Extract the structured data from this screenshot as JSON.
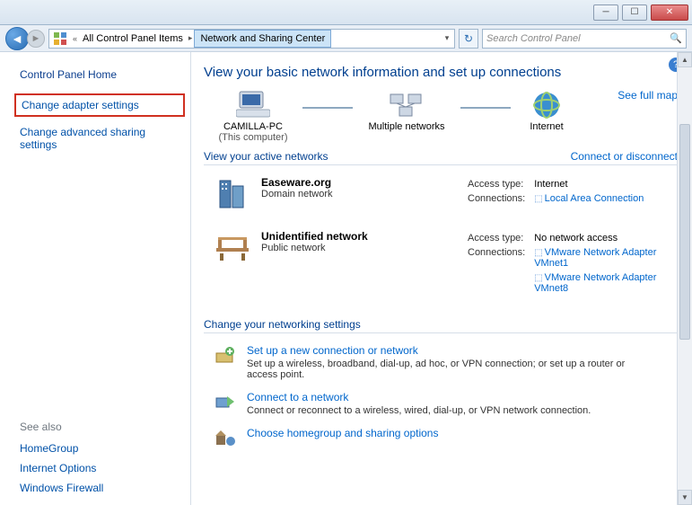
{
  "titlebar": {
    "min": "─",
    "max": "☐",
    "close": "✕"
  },
  "address": {
    "back_glyph": "◄",
    "fwd_glyph": "►",
    "chevrons": "«",
    "crumb1": "All Control Panel Items",
    "crumb2": "Network and Sharing Center",
    "dropdown_glyph": "▾",
    "refresh_glyph": "↻",
    "search_placeholder": "Search Control Panel",
    "search_glyph": "🔍"
  },
  "sidebar": {
    "home": "Control Panel Home",
    "adapter": "Change adapter settings",
    "advanced": "Change advanced sharing settings",
    "seealso": "See also",
    "links": [
      "HomeGroup",
      "Internet Options",
      "Windows Firewall"
    ]
  },
  "main": {
    "help_glyph": "?",
    "title": "View your basic network information and set up connections",
    "map": {
      "pc_name": "CAMILLA-PC",
      "pc_sub": "(This computer)",
      "mid": "Multiple networks",
      "internet": "Internet",
      "full_map": "See full map"
    },
    "active": {
      "heading": "View your active networks",
      "rightlink": "Connect or disconnect",
      "net1": {
        "name": "Easeware.org",
        "type": "Domain network",
        "access_lbl": "Access type:",
        "access_val": "Internet",
        "conn_lbl": "Connections:",
        "conn_val": "Local Area Connection"
      },
      "net2": {
        "name": "Unidentified network",
        "type": "Public network",
        "access_lbl": "Access type:",
        "access_val": "No network access",
        "conn_lbl": "Connections:",
        "conn_val1": "VMware Network Adapter VMnet1",
        "conn_val2": "VMware Network Adapter VMnet8"
      }
    },
    "settings": {
      "heading": "Change your networking settings",
      "task1": {
        "title": "Set up a new connection or network",
        "desc": "Set up a wireless, broadband, dial-up, ad hoc, or VPN connection; or set up a router or access point."
      },
      "task2": {
        "title": "Connect to a network",
        "desc": "Connect or reconnect to a wireless, wired, dial-up, or VPN network connection."
      },
      "task3": {
        "title": "Choose homegroup and sharing options"
      }
    }
  }
}
